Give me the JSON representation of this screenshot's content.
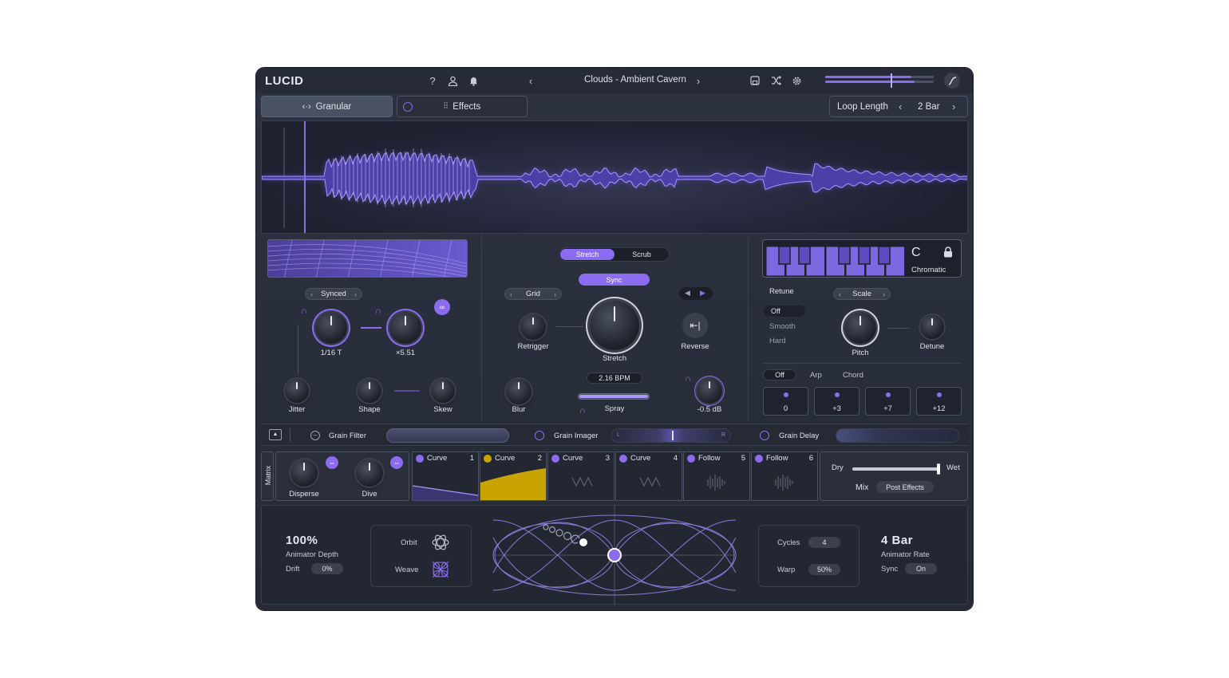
{
  "header": {
    "logo": "LUCID",
    "preset_name": "Clouds - Ambient Cavern",
    "icons": [
      "help-icon",
      "user-icon",
      "bell-icon",
      "save-icon",
      "shuffle-icon",
      "gear-icon",
      "curve-icon"
    ],
    "volume_level": 0.9
  },
  "tabs": {
    "granular": "Granular",
    "effects": "Effects"
  },
  "loop": {
    "label": "Loop Length",
    "value": "2 Bar"
  },
  "left": {
    "mode": "Synced",
    "knob1_value": "1/16 T",
    "knob2_value": "×5.51",
    "jitter": "Jitter",
    "shape": "Shape",
    "skew": "Skew"
  },
  "center": {
    "seg_stretch": "Stretch",
    "seg_scrub": "Scrub",
    "sync": "Sync",
    "grid": "Grid",
    "retrigger": "Retrigger",
    "stretch": "Stretch",
    "reverse": "Reverse",
    "bpm": "2.16 BPM",
    "blur": "Blur",
    "spray": "Spray",
    "gain": "-0.5 dB"
  },
  "right": {
    "key": "C",
    "scale_type": "Chromatic",
    "retune": "Retune",
    "retune_options": [
      "Off",
      "Smooth",
      "Hard"
    ],
    "scale": "Scale",
    "pitch": "Pitch",
    "detune": "Detune",
    "modes": [
      "Off",
      "Arp",
      "Chord"
    ],
    "intervals": [
      "0",
      "+3",
      "+7",
      "+12"
    ]
  },
  "strip": {
    "grain_filter": "Grain Filter",
    "grain_imager": "Grain Imager",
    "grain_delay": "Grain Delay",
    "imager_l": "L",
    "imager_r": "R"
  },
  "matrix": {
    "label": "Matrix",
    "disperse": "Disperse",
    "dive": "Dive",
    "modulators": [
      {
        "name": "Curve",
        "num": "1"
      },
      {
        "name": "Curve",
        "num": "2"
      },
      {
        "name": "Curve",
        "num": "3"
      },
      {
        "name": "Curve",
        "num": "4"
      },
      {
        "name": "Follow",
        "num": "5"
      },
      {
        "name": "Follow",
        "num": "6"
      }
    ],
    "dry": "Dry",
    "wet": "Wet",
    "mix": "Mix",
    "post_effects": "Post Effects"
  },
  "bottom": {
    "depth_value": "100%",
    "depth_label": "Animator Depth",
    "drift_label": "Drift",
    "drift_value": "0%",
    "orbit": "Orbit",
    "weave": "Weave",
    "cycles_label": "Cycles",
    "cycles_value": "4",
    "warp_label": "Warp",
    "warp_value": "50%",
    "rate_value": "4 Bar",
    "rate_label": "Animator Rate",
    "sync_label": "Sync",
    "sync_value": "On"
  },
  "colors": {
    "accent": "#8b6cf0",
    "background": "#2c3240",
    "gold": "#c9a400"
  }
}
